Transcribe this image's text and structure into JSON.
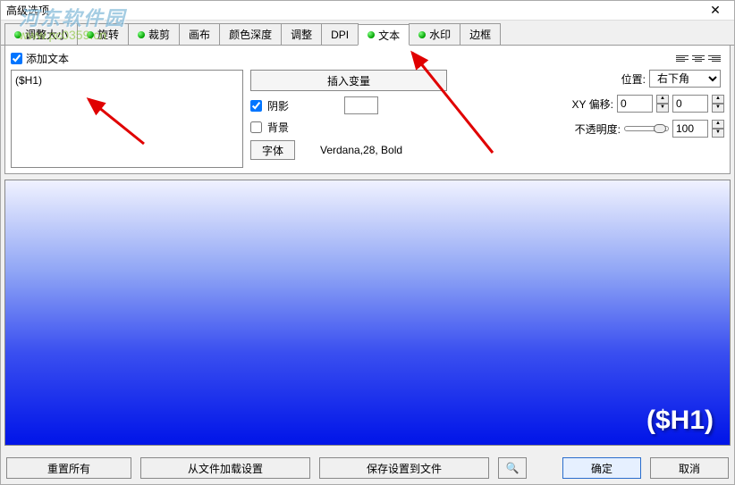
{
  "window": {
    "title": "高级选项"
  },
  "watermark": {
    "line1": "河东软件园",
    "line2": "www.pc0359.cn"
  },
  "tabs": [
    {
      "label": "调整大小",
      "dot": true
    },
    {
      "label": "旋转",
      "dot": true
    },
    {
      "label": "裁剪",
      "dot": true
    },
    {
      "label": "画布",
      "dot": false
    },
    {
      "label": "颜色深度",
      "dot": false
    },
    {
      "label": "调整",
      "dot": false
    },
    {
      "label": "DPI",
      "dot": false
    },
    {
      "label": "文本",
      "dot": true,
      "active": true
    },
    {
      "label": "水印",
      "dot": true
    },
    {
      "label": "边框",
      "dot": false
    }
  ],
  "textPanel": {
    "addTextLabel": "添加文本",
    "addTextChecked": true,
    "textareaValue": "($H1)",
    "insertVarLabel": "插入变量",
    "shadowLabel": "阴影",
    "shadowChecked": true,
    "backgroundLabel": "背景",
    "backgroundChecked": false,
    "fontBtnLabel": "字体",
    "fontInfo": "Verdana,28, Bold",
    "positionLabel": "位置:",
    "positionValue": "右下角",
    "offsetLabel": "XY 偏移:",
    "offsetX": "0",
    "offsetY": "0",
    "opacityLabel": "不透明度:",
    "opacityValue": "100"
  },
  "preview": {
    "sampleText": "($H1)"
  },
  "footer": {
    "resetAll": "重置所有",
    "loadFromFile": "从文件加载设置",
    "saveToFile": "保存设置到文件",
    "ok": "确定",
    "cancel": "取消"
  }
}
